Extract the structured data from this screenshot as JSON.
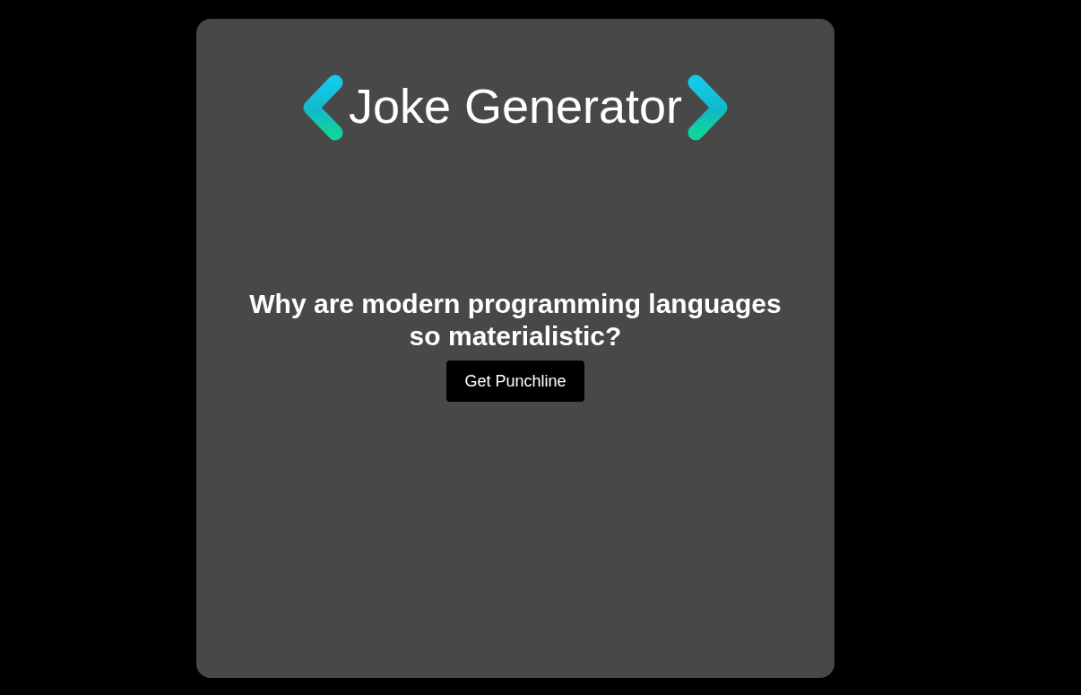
{
  "logo": {
    "title": "Joke Generator"
  },
  "joke": {
    "setup": "Why are modern programming languages so materialistic?"
  },
  "punchline_button": {
    "label": "Get Punchline"
  }
}
